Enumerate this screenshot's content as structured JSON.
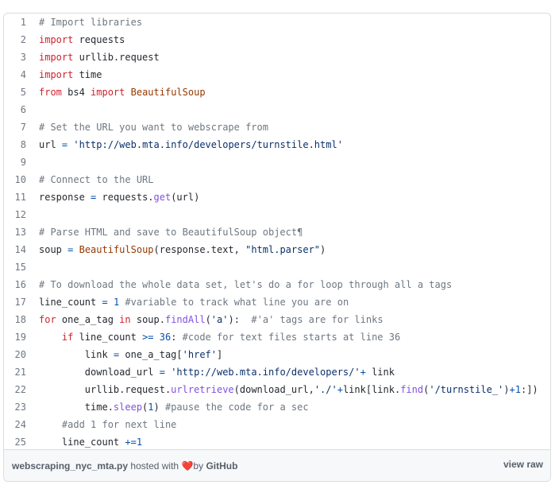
{
  "gist": {
    "filename": "webscraping_nyc_mta.py",
    "hosted_text": "hosted with",
    "heart_glyph": "❤️",
    "by_text": "by",
    "host": "GitHub",
    "view_raw": "view raw",
    "lines": [
      {
        "n": "1",
        "tokens": [
          {
            "c": "comment",
            "t": "# Import libraries"
          }
        ]
      },
      {
        "n": "2",
        "tokens": [
          {
            "c": "keyword",
            "t": "import"
          },
          {
            "c": "plain",
            "t": " requests"
          }
        ]
      },
      {
        "n": "3",
        "tokens": [
          {
            "c": "keyword",
            "t": "import"
          },
          {
            "c": "plain",
            "t": " urllib.request"
          }
        ]
      },
      {
        "n": "4",
        "tokens": [
          {
            "c": "keyword",
            "t": "import"
          },
          {
            "c": "plain",
            "t": " time"
          }
        ]
      },
      {
        "n": "5",
        "tokens": [
          {
            "c": "keyword",
            "t": "from"
          },
          {
            "c": "plain",
            "t": " bs4 "
          },
          {
            "c": "keyword",
            "t": "import"
          },
          {
            "c": "plain",
            "t": " "
          },
          {
            "c": "class",
            "t": "BeautifulSoup"
          }
        ]
      },
      {
        "n": "6",
        "tokens": []
      },
      {
        "n": "7",
        "tokens": [
          {
            "c": "comment",
            "t": "# Set the URL you want to webscrape from"
          }
        ]
      },
      {
        "n": "8",
        "tokens": [
          {
            "c": "plain",
            "t": "url "
          },
          {
            "c": "operator",
            "t": "="
          },
          {
            "c": "plain",
            "t": " "
          },
          {
            "c": "string",
            "t": "'http://web.mta.info/developers/turnstile.html'"
          }
        ]
      },
      {
        "n": "9",
        "tokens": []
      },
      {
        "n": "10",
        "tokens": [
          {
            "c": "comment",
            "t": "# Connect to the URL"
          }
        ]
      },
      {
        "n": "11",
        "tokens": [
          {
            "c": "plain",
            "t": "response "
          },
          {
            "c": "operator",
            "t": "="
          },
          {
            "c": "plain",
            "t": " requests."
          },
          {
            "c": "builtin",
            "t": "get"
          },
          {
            "c": "plain",
            "t": "(url)"
          }
        ]
      },
      {
        "n": "12",
        "tokens": []
      },
      {
        "n": "13",
        "tokens": [
          {
            "c": "comment",
            "t": "# Parse HTML and save to BeautifulSoup object¶"
          }
        ]
      },
      {
        "n": "14",
        "tokens": [
          {
            "c": "plain",
            "t": "soup "
          },
          {
            "c": "operator",
            "t": "="
          },
          {
            "c": "plain",
            "t": " "
          },
          {
            "c": "class",
            "t": "BeautifulSoup"
          },
          {
            "c": "plain",
            "t": "(response.text, "
          },
          {
            "c": "string",
            "t": "\"html.parser\""
          },
          {
            "c": "plain",
            "t": ")"
          }
        ]
      },
      {
        "n": "15",
        "tokens": []
      },
      {
        "n": "16",
        "tokens": [
          {
            "c": "comment",
            "t": "# To download the whole data set, let's do a for loop through all a tags"
          }
        ]
      },
      {
        "n": "17",
        "tokens": [
          {
            "c": "plain",
            "t": "line_count "
          },
          {
            "c": "operator",
            "t": "="
          },
          {
            "c": "plain",
            "t": " "
          },
          {
            "c": "number",
            "t": "1"
          },
          {
            "c": "plain",
            "t": " "
          },
          {
            "c": "comment",
            "t": "#variable to track what line you are on"
          }
        ]
      },
      {
        "n": "18",
        "tokens": [
          {
            "c": "keyword",
            "t": "for"
          },
          {
            "c": "plain",
            "t": " one_a_tag "
          },
          {
            "c": "keyword",
            "t": "in"
          },
          {
            "c": "plain",
            "t": " soup."
          },
          {
            "c": "builtin",
            "t": "findAll"
          },
          {
            "c": "plain",
            "t": "("
          },
          {
            "c": "string",
            "t": "'a'"
          },
          {
            "c": "plain",
            "t": "):  "
          },
          {
            "c": "comment",
            "t": "#'a' tags are for links"
          }
        ]
      },
      {
        "n": "19",
        "tokens": [
          {
            "c": "plain",
            "t": "    "
          },
          {
            "c": "keyword",
            "t": "if"
          },
          {
            "c": "plain",
            "t": " line_count "
          },
          {
            "c": "operator",
            "t": ">="
          },
          {
            "c": "plain",
            "t": " "
          },
          {
            "c": "number",
            "t": "36"
          },
          {
            "c": "plain",
            "t": ": "
          },
          {
            "c": "comment",
            "t": "#code for text files starts at line 36"
          }
        ]
      },
      {
        "n": "20",
        "tokens": [
          {
            "c": "plain",
            "t": "        link "
          },
          {
            "c": "operator",
            "t": "="
          },
          {
            "c": "plain",
            "t": " one_a_tag["
          },
          {
            "c": "string",
            "t": "'href'"
          },
          {
            "c": "plain",
            "t": "]"
          }
        ]
      },
      {
        "n": "21",
        "tokens": [
          {
            "c": "plain",
            "t": "        download_url "
          },
          {
            "c": "operator",
            "t": "="
          },
          {
            "c": "plain",
            "t": " "
          },
          {
            "c": "string",
            "t": "'http://web.mta.info/developers/'"
          },
          {
            "c": "operator",
            "t": "+"
          },
          {
            "c": "plain",
            "t": " link"
          }
        ]
      },
      {
        "n": "22",
        "tokens": [
          {
            "c": "plain",
            "t": "        urllib.request."
          },
          {
            "c": "builtin",
            "t": "urlretrieve"
          },
          {
            "c": "plain",
            "t": "(download_url,"
          },
          {
            "c": "string",
            "t": "'./'"
          },
          {
            "c": "operator",
            "t": "+"
          },
          {
            "c": "plain",
            "t": "link[link."
          },
          {
            "c": "builtin",
            "t": "find"
          },
          {
            "c": "plain",
            "t": "("
          },
          {
            "c": "string",
            "t": "'/turnstile_'"
          },
          {
            "c": "plain",
            "t": ")"
          },
          {
            "c": "operator",
            "t": "+"
          },
          {
            "c": "number",
            "t": "1"
          },
          {
            "c": "plain",
            "t": ":])"
          }
        ]
      },
      {
        "n": "23",
        "tokens": [
          {
            "c": "plain",
            "t": "        time."
          },
          {
            "c": "builtin",
            "t": "sleep"
          },
          {
            "c": "plain",
            "t": "("
          },
          {
            "c": "number",
            "t": "1"
          },
          {
            "c": "plain",
            "t": ") "
          },
          {
            "c": "comment",
            "t": "#pause the code for a sec"
          }
        ]
      },
      {
        "n": "24",
        "tokens": [
          {
            "c": "plain",
            "t": "    "
          },
          {
            "c": "comment",
            "t": "#add 1 for next line"
          }
        ]
      },
      {
        "n": "25",
        "tokens": [
          {
            "c": "plain",
            "t": "    line_count "
          },
          {
            "c": "operator",
            "t": "+="
          },
          {
            "c": "number",
            "t": "1"
          }
        ]
      }
    ]
  }
}
